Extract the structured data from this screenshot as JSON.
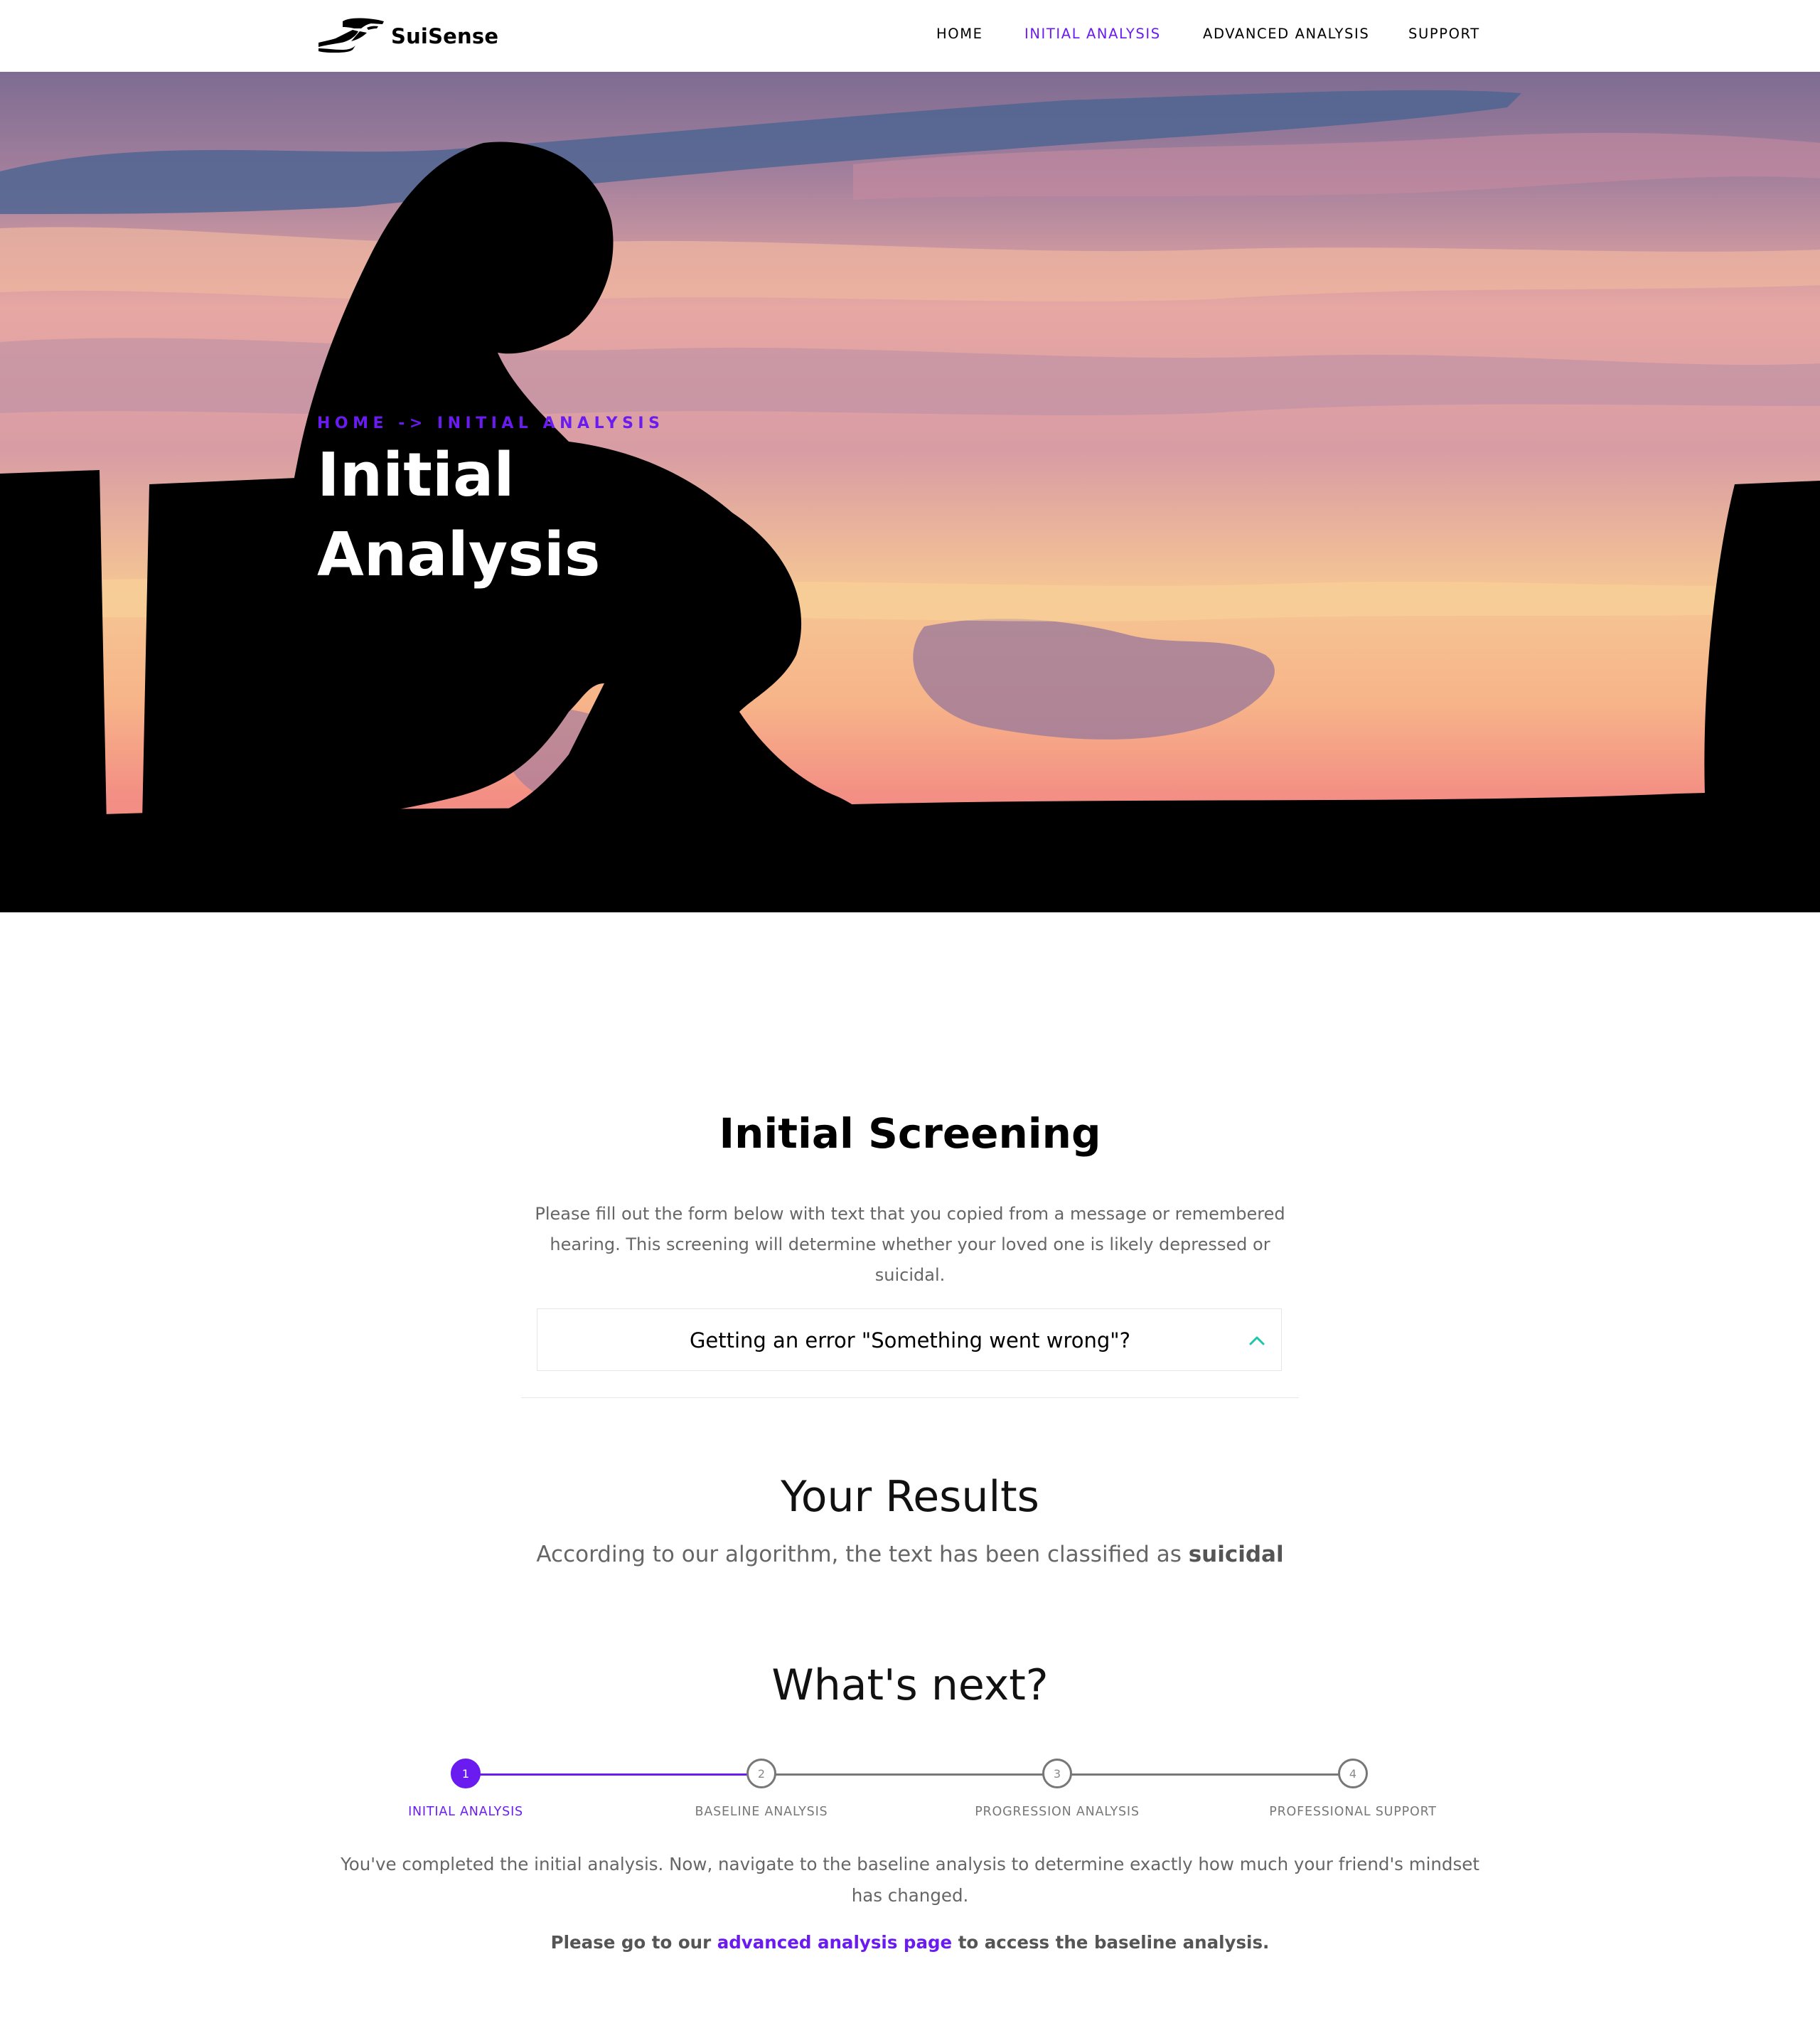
{
  "brand": {
    "name": "SuiSense",
    "icon": "helping-hands-icon"
  },
  "nav": {
    "items": [
      {
        "label": "HOME",
        "active": false
      },
      {
        "label": "INITIAL ANALYSIS",
        "active": true
      },
      {
        "label": "ADVANCED ANALYSIS",
        "active": false
      },
      {
        "label": "SUPPORT",
        "active": false
      }
    ]
  },
  "hero": {
    "breadcrumb": "HOME -> INITIAL ANALYSIS",
    "title": "Initial Analysis",
    "image": "silhouette-girl-sunset-image"
  },
  "screening": {
    "title": "Initial Screening",
    "intro": "Please fill out the form below with text that you copied from a message or remembered hearing. This screening will determine whether your loved one is likely depressed or suicidal.",
    "faq_question": "Getting an error \"Something went wrong\"?",
    "faq_icon": "chevron-up-icon"
  },
  "results": {
    "title": "Your Results",
    "text_prefix": "According to our algorithm, the text has been classified as",
    "classification": "suicidal"
  },
  "next": {
    "title": "What's next?",
    "steps": [
      {
        "number": "1",
        "label": "INITIAL ANALYSIS",
        "completed": true
      },
      {
        "number": "2",
        "label": "BASELINE ANALYSIS",
        "completed": false
      },
      {
        "number": "3",
        "label": "PROGRESSION ANALYSIS",
        "completed": false
      },
      {
        "number": "4",
        "label": "PROFESSIONAL SUPPORT",
        "completed": false
      }
    ],
    "description": "You've completed the initial analysis. Now, navigate to the baseline analysis to determine exactly how much your friend's mindset has changed.",
    "cta_prefix": "Please go to our",
    "cta_link": "advanced analysis page",
    "cta_suffix": "to access the baseline analysis."
  },
  "colors": {
    "accent": "#6a1bf0",
    "teal": "#1cc7a6",
    "text": "#000000",
    "muted": "#666666"
  }
}
